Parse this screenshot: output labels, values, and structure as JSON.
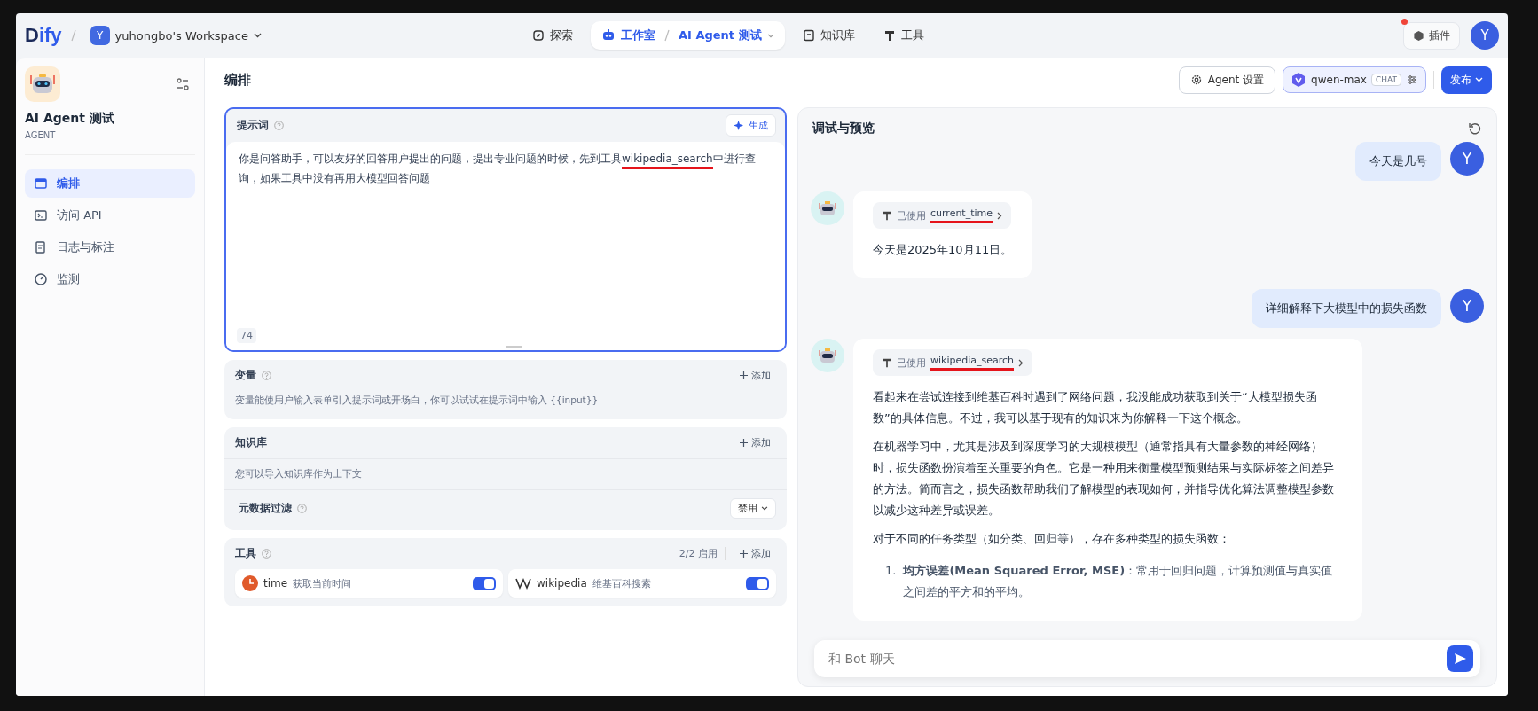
{
  "nav": {
    "logo_a": "D",
    "logo_b": "ify",
    "workspace_initial": "Y",
    "workspace": "yuhongbo's Workspace",
    "items": [
      {
        "label": "探索",
        "selected": false
      },
      {
        "label": "工作室",
        "selected": true,
        "sub": "AI Agent 测试"
      },
      {
        "label": "知识库",
        "selected": false
      },
      {
        "label": "工具",
        "selected": false
      }
    ],
    "plugins": "插件",
    "avatar": "Y"
  },
  "sidebar": {
    "app_name": "AI Agent 测试",
    "app_type": "AGENT",
    "items": [
      {
        "label": "编排",
        "selected": true
      },
      {
        "label": "访问 API",
        "selected": false
      },
      {
        "label": "日志与标注",
        "selected": false
      },
      {
        "label": "监测",
        "selected": false
      }
    ]
  },
  "editor": {
    "title": "编排",
    "prompt": {
      "label": "提示词",
      "generate": "生成",
      "value_parts": [
        {
          "text": "你是问答助手，可以友好的回答用户提出的问题，提出专业问题的时候，先到工具",
          "underlined": false
        },
        {
          "text": "wikipedia_search",
          "underlined": true
        },
        {
          "text": "中进行查询，如果工具中没有再用大模型回答问题",
          "underlined": false
        }
      ],
      "count": "74"
    },
    "variables": {
      "label": "变量",
      "add": "添加",
      "hint": "变量能使用户输入表单引入提示词或开场白，你可以试试在提示词中输入 {{input}}"
    },
    "knowledge": {
      "label": "知识库",
      "add": "添加",
      "hint": "您可以导入知识库作为上下文",
      "filter_label": "元数据过滤",
      "filter_value": "禁用"
    },
    "tools": {
      "label": "工具",
      "count": "2/2 启用",
      "add": "添加",
      "items": [
        {
          "name": "time",
          "desc": "获取当前时间",
          "on": true
        },
        {
          "name": "wikipedia",
          "desc": "维基百科搜索",
          "on": true
        }
      ]
    }
  },
  "actions": {
    "agent_settings": "Agent 设置",
    "model": "qwen-max",
    "model_tag": "CHAT",
    "publish": "发布"
  },
  "preview": {
    "title": "调试与预览",
    "messages": [
      {
        "kind": "user",
        "avatar": "Y",
        "text": "今天是几号"
      },
      {
        "kind": "bot",
        "tool": {
          "prefix": "已使用",
          "name": "current_time",
          "underlined": true
        },
        "paragraphs": [
          "今天是2025年10月11日。"
        ]
      },
      {
        "kind": "user",
        "avatar": "Y",
        "text": "详细解释下大模型中的损失函数"
      },
      {
        "kind": "bot",
        "tool": {
          "prefix": "已使用",
          "name": "wikipedia_search",
          "underlined": true
        },
        "paragraphs": [
          "看起来在尝试连接到维基百科时遇到了网络问题，我没能成功获取到关于“大模型损失函数”的具体信息。不过，我可以基于现有的知识来为你解释一下这个概念。",
          "在机器学习中，尤其是涉及到深度学习的大规模模型（通常指具有大量参数的神经网络）时，损失函数扮演着至关重要的角色。它是一种用来衡量模型预测结果与实际标签之间差异的方法。简而言之，损失函数帮助我们了解模型的表现如何，并指导优化算法调整模型参数以减少这种差异或误差。",
          "对于不同的任务类型（如分类、回归等），存在多种类型的损失函数："
        ],
        "list_items": [
          {
            "number": "1.",
            "text": "**均方误差(Mean Squared Error, MSE)**：常用于回归问题，计算预测值与真实值之间差的平方和的平均。"
          }
        ]
      }
    ],
    "input_placeholder": "和 Bot 聊天"
  }
}
